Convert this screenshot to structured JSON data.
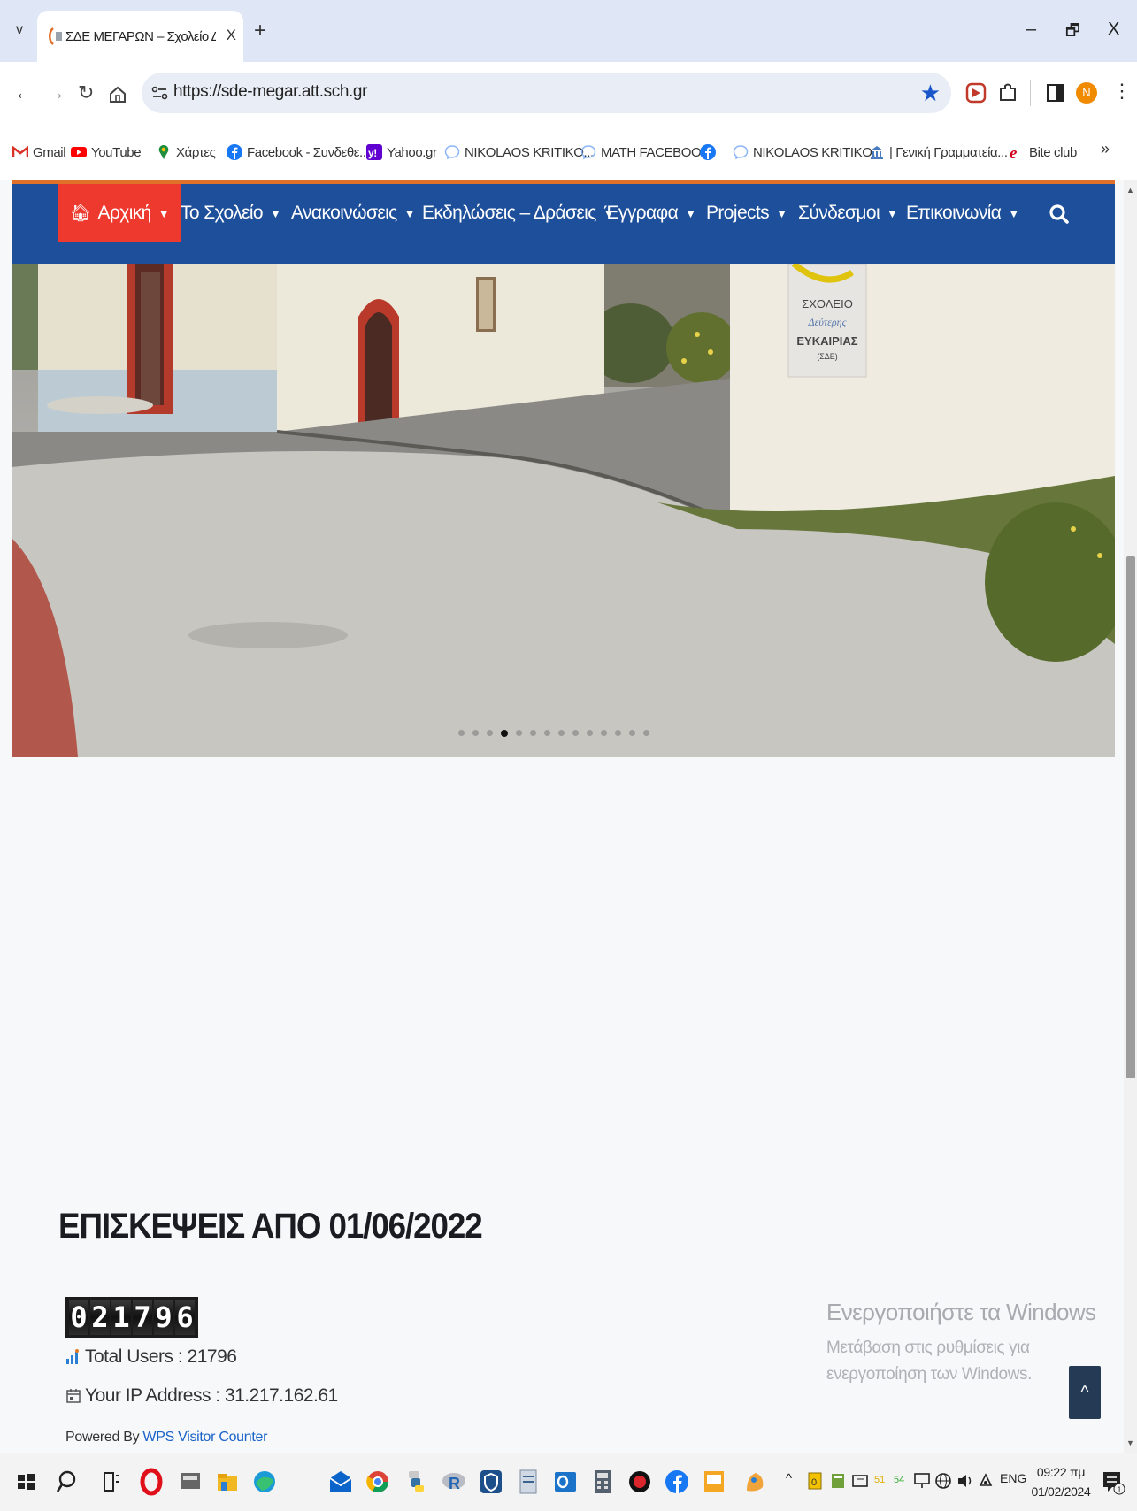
{
  "browser": {
    "tab_title": "ΣΔΕ ΜΕΓΑΡΩΝ – Σχολείο Δεύτε",
    "tab_close": "X",
    "new_tab": "+",
    "tab_menu": "v",
    "minimize": "–",
    "restore": "🗗",
    "close": "X",
    "url": "https://sde-megar.att.sch.gr",
    "profile_initial": "N",
    "colors": {
      "tabstrip": "#dfe7f7",
      "star": "#1a55c9",
      "avatar": "#f08a00"
    }
  },
  "bookmarks": [
    {
      "label": "Gmail",
      "icon": "gmail-icon",
      "color": "#d93025"
    },
    {
      "label": "YouTube",
      "icon": "youtube-icon",
      "color": "#ff0000"
    },
    {
      "label": "Χάρτες",
      "icon": "maps-icon",
      "color": "#1e8e3e"
    },
    {
      "label": "Facebook - Συνδεθε...",
      "icon": "facebook-icon",
      "color": "#1877f2"
    },
    {
      "label": "Yahoo.gr",
      "icon": "yahoo-icon",
      "color": "#6001d2"
    },
    {
      "label": "NIKOLAOS KRITIKO...",
      "icon": "messenger-icon",
      "color": "#8ab4f8"
    },
    {
      "label": "MATH FACEBOOK",
      "icon": "messenger-icon",
      "color": "#8ab4f8"
    },
    {
      "label": "",
      "icon": "facebook-icon",
      "color": "#1877f2"
    },
    {
      "label": "NIKOLAOS KRITIKO...",
      "icon": "messenger-icon",
      "color": "#8ab4f8"
    },
    {
      "label": "| Γενική Γραμματεία...",
      "icon": "ministry-icon",
      "color": "#4a7bbf"
    },
    {
      "label": "Bite club",
      "icon": "edge-e-icon",
      "color": "#d0021b"
    }
  ],
  "bookmarks_more": "»",
  "site": {
    "nav": [
      {
        "label": "Αρχική",
        "active": true
      },
      {
        "label": "Το Σχολείο"
      },
      {
        "label": "Ανακοινώσεις"
      },
      {
        "label": "Εκδηλώσεις – Δράσεις"
      },
      {
        "label": "Έγγραφα"
      },
      {
        "label": "Projects"
      },
      {
        "label": "Σύνδεσμοι"
      },
      {
        "label": "Επικοινωνία"
      }
    ],
    "caret": "▼",
    "colors": {
      "navbar": "#1e4f9a",
      "active": "#ee3a2e",
      "rule": "#e0702a"
    },
    "slider": {
      "dot_count": 14,
      "active_index": 3
    },
    "sign_text": [
      "ΣΧΟΛΕΙΟ",
      "Δεύτερης",
      "ΕΥΚΑΙΡΙΑΣ",
      "(ΣΔΕ)"
    ],
    "visits_title": "ΕΠΙΣΚΕΨΕΙΣ ΑΠΟ 01/06/2022",
    "counter_digits": [
      "0",
      "2",
      "1",
      "7",
      "9",
      "6"
    ],
    "total_users": "Total Users : 21796",
    "ip_address": "Your IP Address : 31.217.162.61",
    "powered_by": "Powered By ",
    "powered_link": "WPS Visitor Counter",
    "back_to_top": "^"
  },
  "windows_activation": {
    "title": "Ενεργοποιήστε τα Windows",
    "subtitle": "Μετάβαση στις ρυθμίσεις για ενεργοποίηση των Windows."
  },
  "taskbar": {
    "tray_up": "^",
    "lang": "ENG",
    "tray_51": "51",
    "tray_54": "54",
    "time": "09:22 πμ",
    "date": "01/02/2024",
    "notifications": "1"
  }
}
